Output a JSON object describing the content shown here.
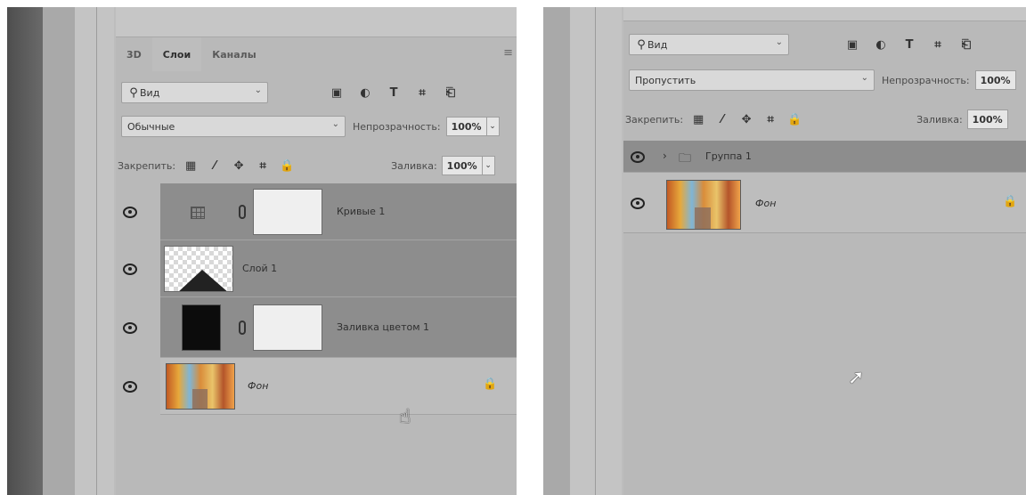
{
  "left": {
    "tabs": [
      "3D",
      "Слои",
      "Каналы"
    ],
    "active_tab": "Слои",
    "filter": {
      "label": "Вид"
    },
    "blend_mode": "Обычные",
    "opacity": {
      "label": "Непрозрачность:",
      "value": "100%"
    },
    "lock": {
      "label": "Закрепить:"
    },
    "fill": {
      "label": "Заливка:",
      "value": "100%"
    },
    "layers": [
      {
        "name": "Кривые 1"
      },
      {
        "name": "Слой 1"
      },
      {
        "name": "Заливка цветом 1"
      },
      {
        "name": "Фон"
      }
    ]
  },
  "right": {
    "filter": {
      "label": "Вид"
    },
    "blend_mode": "Пропустить",
    "opacity": {
      "label": "Непрозрачность:",
      "value": "100%"
    },
    "lock": {
      "label": "Закрепить:"
    },
    "fill": {
      "label": "Заливка:",
      "value": "100%"
    },
    "layers": [
      {
        "name": "Группа 1"
      },
      {
        "name": "Фон"
      }
    ]
  }
}
